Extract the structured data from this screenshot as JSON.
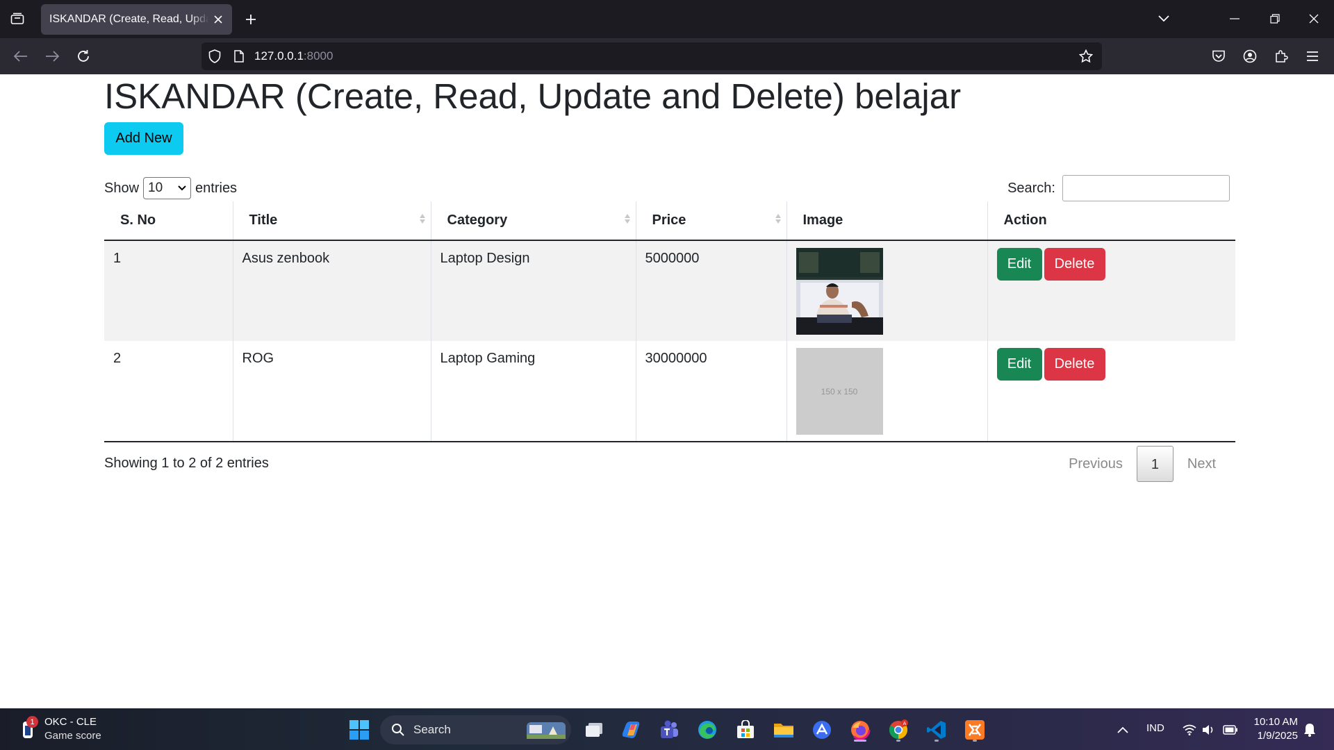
{
  "browser": {
    "tab_title": "ISKANDAR (Create, Read, Update and Delete) belajar",
    "url_host": "127.0.0.1",
    "url_port": ":8000"
  },
  "page": {
    "title": "ISKANDAR (Create, Read, Update and Delete) belajar",
    "add_button": "Add New",
    "show_label": "Show",
    "entries_value": "10",
    "entries_label": "entries",
    "search_label": "Search:",
    "columns": [
      "S. No",
      "Title",
      "Category",
      "Price",
      "Image",
      "Action"
    ],
    "rows": [
      {
        "no": "1",
        "title": "Asus zenbook",
        "category": "Laptop Design",
        "price": "5000000",
        "image": "photo"
      },
      {
        "no": "2",
        "title": "ROG",
        "category": "Laptop Gaming",
        "price": "30000000",
        "image": "150 x 150"
      }
    ],
    "edit_label": "Edit",
    "delete_label": "Delete",
    "info": "Showing 1 to 2 of 2 entries",
    "pagination": {
      "previous": "Previous",
      "current": "1",
      "next": "Next"
    }
  },
  "taskbar": {
    "weather_badge": "1",
    "weather_title": "OKC - CLE",
    "weather_sub": "Game score",
    "search_label": "Search",
    "lang": "IND",
    "time": "10:10 AM",
    "date": "1/9/2025"
  },
  "colors": {
    "add_button": "#0dcaf0",
    "edit_button": "#198754",
    "delete_button": "#dc3545"
  }
}
